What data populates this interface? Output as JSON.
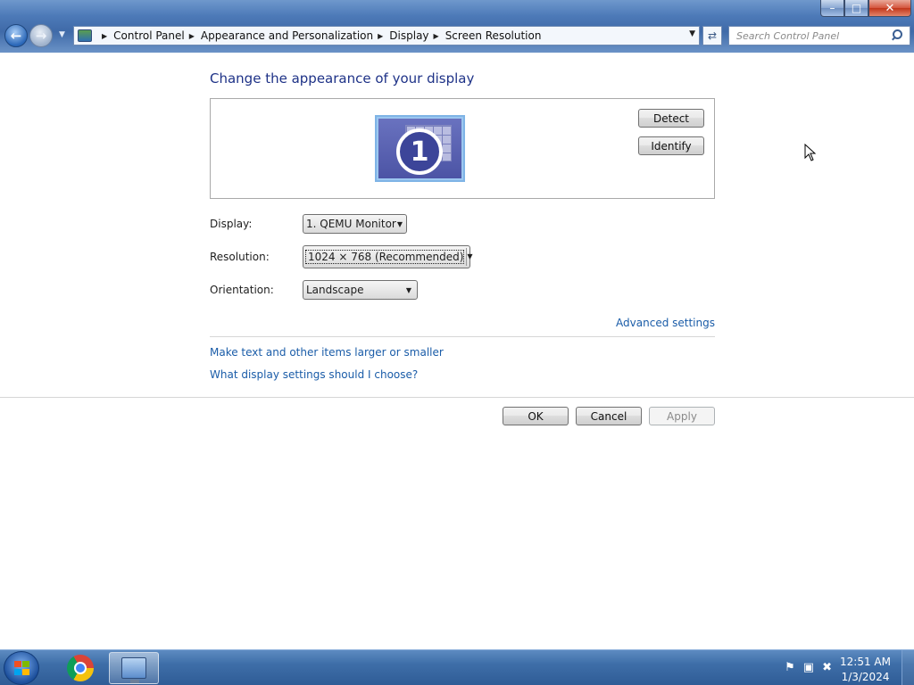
{
  "window": {
    "title": "Screen Resolution",
    "controls": {
      "minimize": "–",
      "maximize": "□",
      "close": "✕"
    }
  },
  "nav": {
    "back_icon": "back-arrow-icon",
    "forward_icon": "forward-arrow-icon",
    "breadcrumbs": [
      "Control Panel",
      "Appearance and Personalization",
      "Display",
      "Screen Resolution"
    ],
    "search_placeholder": "Search Control Panel"
  },
  "main": {
    "heading": "Change the appearance of your display",
    "monitor_number": "1",
    "detect_label": "Detect",
    "identify_label": "Identify",
    "display_label": "Display:",
    "display_value": "1. QEMU Monitor",
    "resolution_label": "Resolution:",
    "resolution_value": "1024 × 768 (Recommended)",
    "orientation_label": "Orientation:",
    "orientation_value": "Landscape",
    "advanced_link": "Advanced settings",
    "link_text_size": "Make text and other items larger or smaller",
    "link_help": "What display settings should I choose?",
    "ok_label": "OK",
    "cancel_label": "Cancel",
    "apply_label": "Apply"
  },
  "taskbar": {
    "time": "12:51 AM",
    "date": "1/3/2024",
    "items": [
      "start-orb",
      "chrome",
      "screen-resolution"
    ],
    "tray_icons": [
      "action-center-flag-icon",
      "network-icon",
      "volume-muted-icon"
    ]
  },
  "colors": {
    "heading": "#1e3287",
    "link": "#1a5ca8",
    "titlebar": "#4d7ab8"
  }
}
